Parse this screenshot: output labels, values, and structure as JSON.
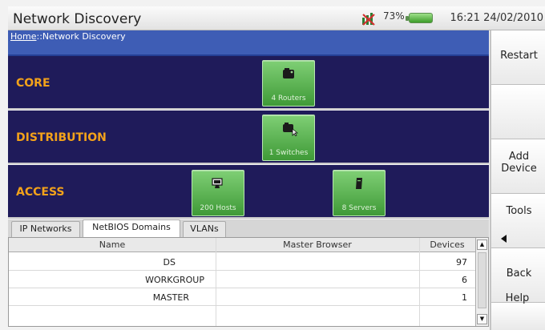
{
  "titlebar": {
    "title": "Network Discovery",
    "battery_percent": "73%",
    "clock": "16:21 24/02/2010"
  },
  "breadcrumb": {
    "home": "Home",
    "separator": "::",
    "current": "Network Discovery"
  },
  "tiers": [
    {
      "label": "CORE",
      "devices": [
        {
          "label": "4 Routers",
          "icon": "router-icon"
        }
      ]
    },
    {
      "label": "DISTRIBUTION",
      "devices": [
        {
          "label": "1 Switches",
          "icon": "switch-icon"
        }
      ]
    },
    {
      "label": "ACCESS",
      "devices": [
        {
          "label": "200 Hosts",
          "icon": "host-icon"
        },
        {
          "label": "8 Servers",
          "icon": "server-icon"
        }
      ]
    }
  ],
  "tabs": [
    {
      "label": "IP Networks",
      "active": false
    },
    {
      "label": "NetBIOS Domains",
      "active": true
    },
    {
      "label": "VLANs",
      "active": false
    }
  ],
  "table": {
    "columns": [
      "Name",
      "Master Browser",
      "Devices"
    ],
    "rows": [
      {
        "name": "DS",
        "master_browser": "",
        "devices": "97"
      },
      {
        "name": "WORKGROUP",
        "master_browser": "",
        "devices": "6"
      },
      {
        "name": "MASTER",
        "master_browser": "",
        "devices": "1"
      }
    ]
  },
  "softkeys": [
    {
      "label": "Restart"
    },
    {
      "label": ""
    },
    {
      "label": "Add Device"
    },
    {
      "label": "Tools"
    },
    {
      "label": "Back"
    },
    {
      "label": "Help"
    }
  ],
  "colors": {
    "tier_bg": "#1f1b5a",
    "tier_label": "#f3a21a",
    "device_button": "#5fb856",
    "breadcrumb_bg": "#3e5db5"
  }
}
